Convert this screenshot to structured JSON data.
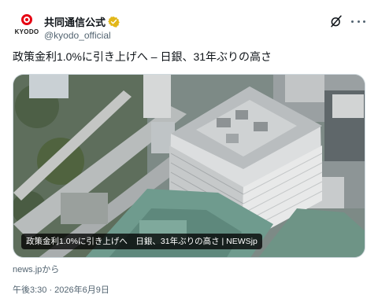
{
  "account": {
    "logo_text": "KYODO",
    "display_name": "共同通信公式",
    "handle": "@kyodo_official",
    "brand_color": "#e60012",
    "verified_color": "#e2b719"
  },
  "actions": {
    "grok_icon": "grok-slash-icon",
    "more_icon": "more-dots-icon"
  },
  "tweet": {
    "text": "政策金利1.0%に引き上げへ – 日銀、31年ぶりの高さ"
  },
  "card": {
    "caption": "政策金利1.0%に引き上げへ　日銀、31年ぶりの高さ | NEWSjp",
    "source": "news.jpから"
  },
  "timestamp": "午後3:30 · 2026年6月9日"
}
